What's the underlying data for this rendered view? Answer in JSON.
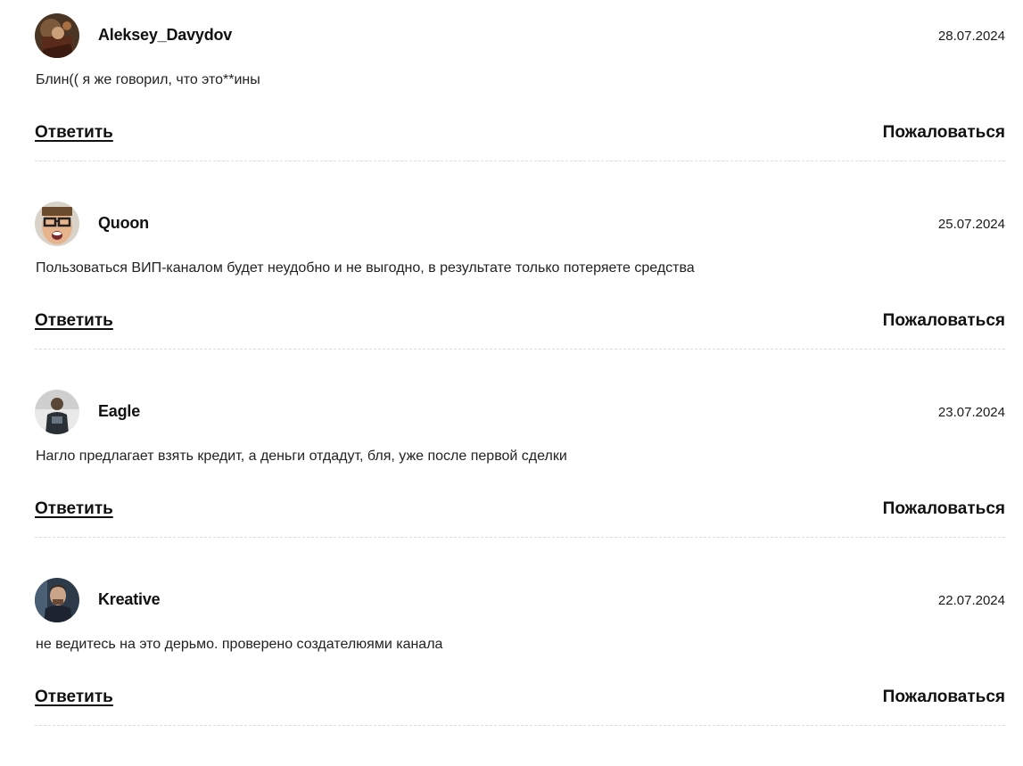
{
  "comments": [
    {
      "author": "Aleksey_Davydov",
      "date": "28.07.2024",
      "text": "Блин(( я же говорил, что это**ины",
      "reply_label": "Ответить",
      "report_label": "Пожаловаться",
      "avatar_icon": "user-avatar"
    },
    {
      "author": "Quoon",
      "date": "25.07.2024",
      "text": "Пользоваться ВИП-каналом будет неудобно и не выгодно, в результате только потеряете средства",
      "reply_label": "Ответить",
      "report_label": "Пожаловаться",
      "avatar_icon": "user-avatar"
    },
    {
      "author": "Eagle",
      "date": "23.07.2024",
      "text": "Нагло предлагает взять кредит, а деньги отдадут, бля, уже после первой сделки",
      "reply_label": "Ответить",
      "report_label": "Пожаловаться",
      "avatar_icon": "user-avatar"
    },
    {
      "author": "Kreative",
      "date": "22.07.2024",
      "text": "не ведитесь на это дерьмо. проверено создателюями канала",
      "reply_label": "Ответить",
      "report_label": "Пожаловаться",
      "avatar_icon": "user-avatar"
    }
  ]
}
